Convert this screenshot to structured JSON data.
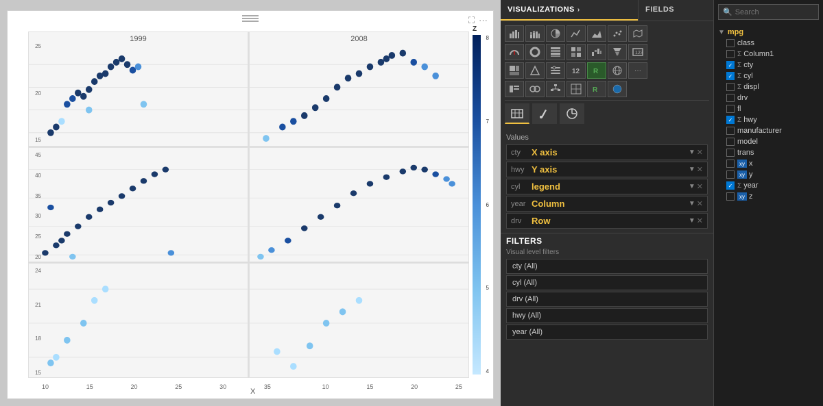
{
  "header": {
    "visualizations_label": "VISUALIZATIONS",
    "fields_label": "FIELDS"
  },
  "toolbar": {
    "drag_icon": "≡",
    "expand_icon": "⛶",
    "more_icon": "···"
  },
  "chart": {
    "title": "",
    "x_label": "X",
    "panels": [
      {
        "col": 0,
        "row": 0,
        "year": "1999"
      },
      {
        "col": 1,
        "row": 0,
        "year": "2008"
      },
      {
        "col": 0,
        "row": 1,
        "year": ""
      },
      {
        "col": 1,
        "row": 1,
        "year": ""
      },
      {
        "col": 0,
        "row": 2,
        "year": ""
      },
      {
        "col": 1,
        "row": 2,
        "year": ""
      }
    ],
    "legend": {
      "title": "Z",
      "values": [
        "8",
        "7",
        "6",
        "5",
        "4"
      ]
    }
  },
  "visualizations_panel": {
    "values_label": "Values",
    "field_rows": [
      {
        "tag": "cty",
        "value": "X axis",
        "has_x": true
      },
      {
        "tag": "hwy",
        "value": "Y axis",
        "has_x": true
      },
      {
        "tag": "cyl",
        "value": "legend",
        "has_x": true
      },
      {
        "tag": "year",
        "value": "Column",
        "has_x": true
      },
      {
        "tag": "drv",
        "value": "Row",
        "has_x": true
      }
    ]
  },
  "filters_panel": {
    "title": "FILTERS",
    "sublabel": "Visual level filters",
    "items": [
      "cty (All)",
      "cyl (All)",
      "drv (All)",
      "hwy (All)",
      "year (All)"
    ]
  },
  "fields_panel": {
    "search_placeholder": "Search",
    "dataset_name": "mpg",
    "fields": [
      {
        "name": "class",
        "checked": false,
        "sigma": false,
        "type": "text"
      },
      {
        "name": "Column1",
        "checked": false,
        "sigma": true,
        "type": "sigma"
      },
      {
        "name": "cty",
        "checked": true,
        "sigma": true,
        "type": "sigma"
      },
      {
        "name": "cyl",
        "checked": true,
        "sigma": true,
        "type": "sigma"
      },
      {
        "name": "displ",
        "checked": false,
        "sigma": true,
        "type": "sigma"
      },
      {
        "name": "drv",
        "checked": false,
        "sigma": false,
        "type": "text"
      },
      {
        "name": "fl",
        "checked": false,
        "sigma": false,
        "type": "text"
      },
      {
        "name": "hwy",
        "checked": true,
        "sigma": true,
        "type": "sigma"
      },
      {
        "name": "manufacturer",
        "checked": false,
        "sigma": false,
        "type": "text"
      },
      {
        "name": "model",
        "checked": false,
        "sigma": false,
        "type": "text"
      },
      {
        "name": "trans",
        "checked": false,
        "sigma": false,
        "type": "text"
      },
      {
        "name": "x",
        "checked": false,
        "sigma": false,
        "type": "xy"
      },
      {
        "name": "y",
        "checked": false,
        "sigma": false,
        "type": "xy"
      },
      {
        "name": "year",
        "checked": true,
        "sigma": true,
        "type": "sigma"
      },
      {
        "name": "z",
        "checked": false,
        "sigma": false,
        "type": "xy"
      }
    ]
  }
}
